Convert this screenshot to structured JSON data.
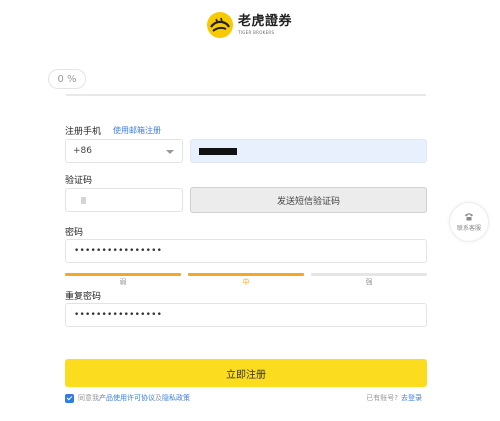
{
  "brand": {
    "name_cn": "老虎證券",
    "name_en": "TIGER BROKERS",
    "color": "#F7C900"
  },
  "progress": {
    "label": "0 %",
    "percent": 0
  },
  "form": {
    "phone_label": "注册手机",
    "email_link": "使用邮箱注册",
    "country_code": "+86",
    "code_label": "验证码",
    "sms_button": "发送短信验证码",
    "password_label": "密码",
    "password_value": "••••••••••••••••",
    "strength": [
      {
        "label": "弱",
        "bar_color": "#F5A623",
        "label_color": "#999999"
      },
      {
        "label": "中",
        "bar_color": "#F5A623",
        "label_color": "#F5A623"
      },
      {
        "label": "强",
        "bar_color": "#E5E5E5",
        "label_color": "#999999"
      }
    ],
    "confirm_label": "重复密码",
    "confirm_value": "••••••••••••••••",
    "submit": "立即注册",
    "submit_color": "#FCDC1F"
  },
  "agreement": {
    "prefix": "同意我",
    "terms": "产品使用许可协议",
    "and": "及",
    "privacy": "隐私政策",
    "checked": true
  },
  "login": {
    "prompt": "已有账号?",
    "link": "去登录"
  },
  "service": {
    "label": "联系客服",
    "icon": "phone-icon"
  }
}
